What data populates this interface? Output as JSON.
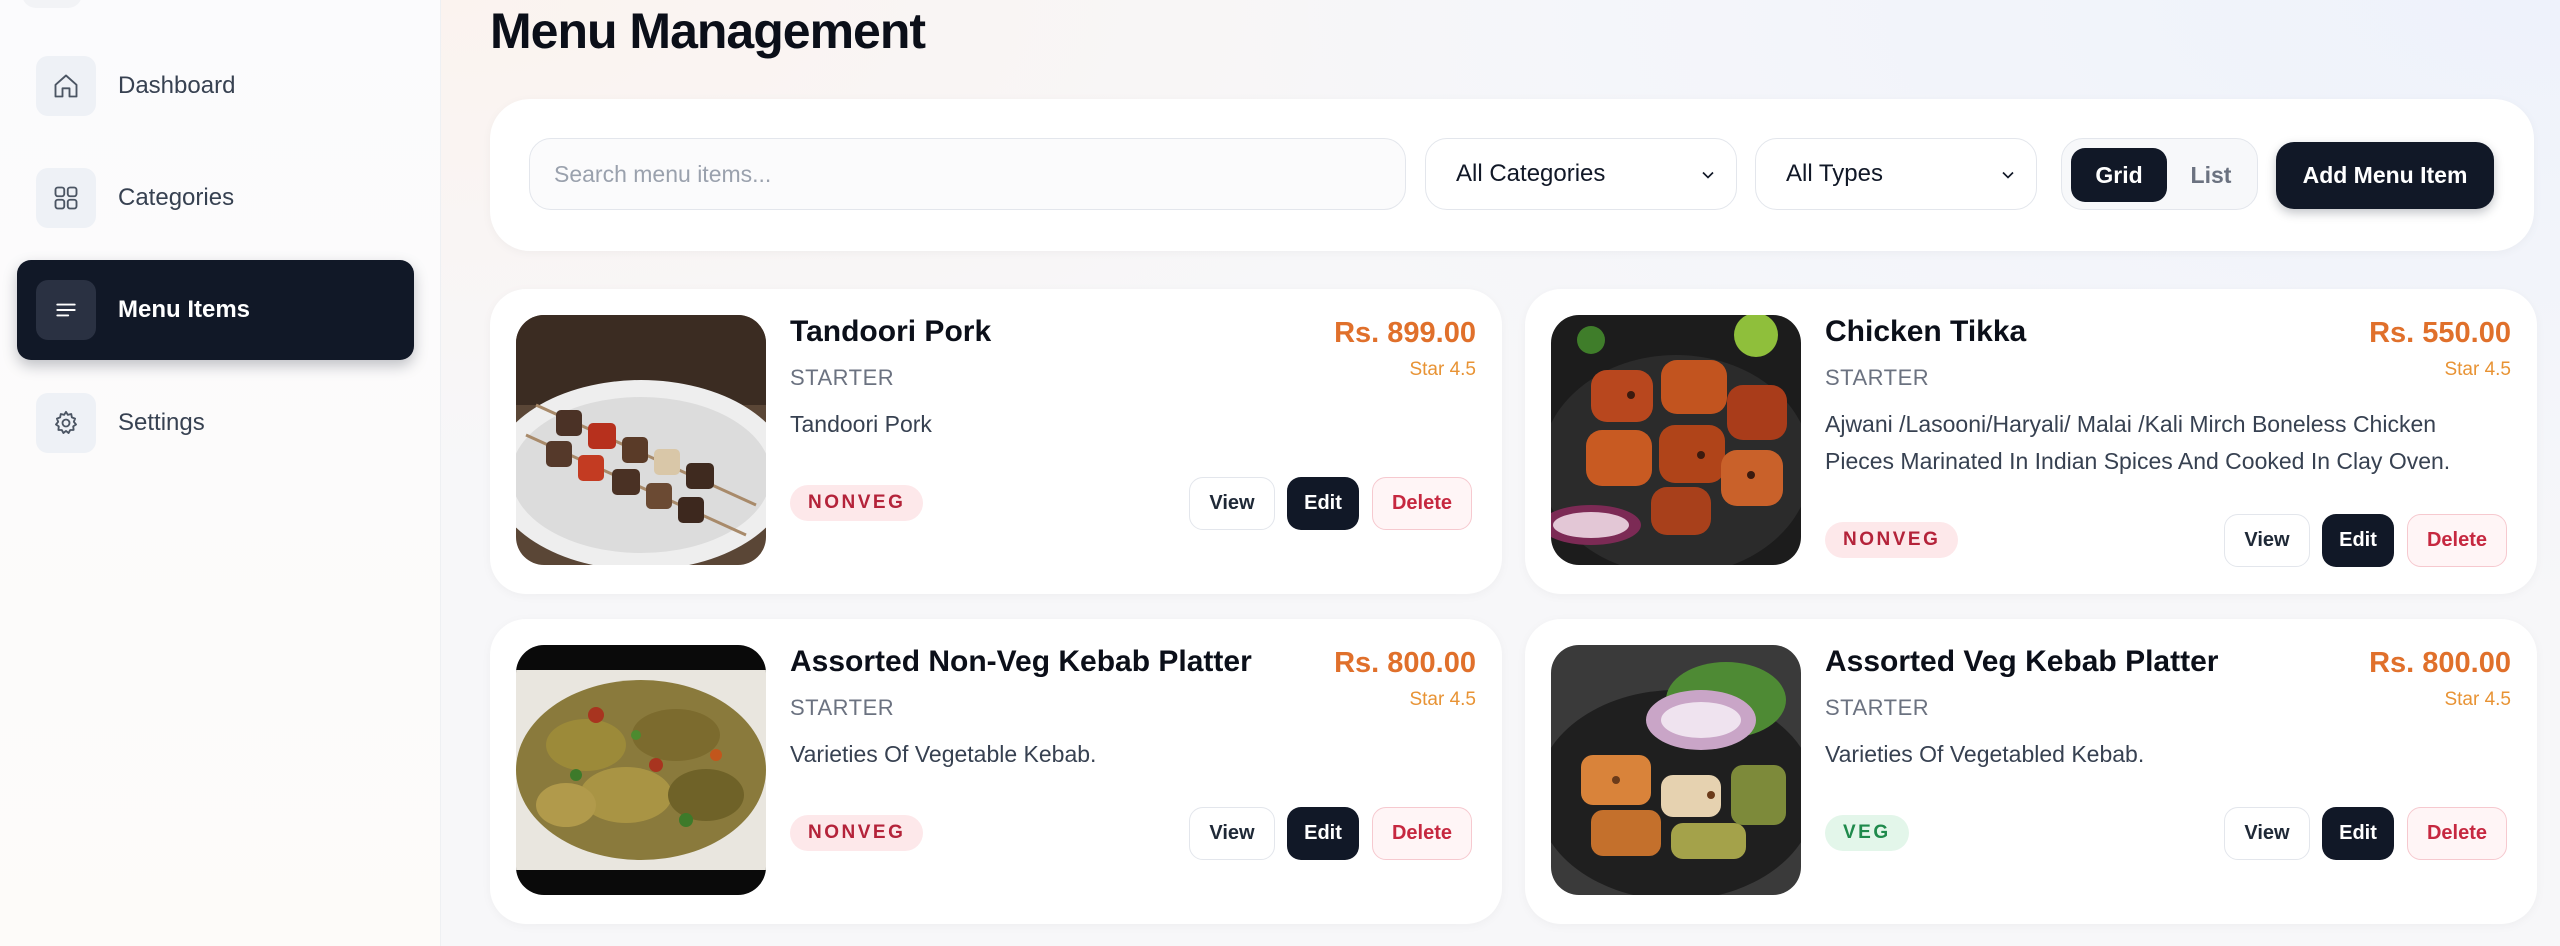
{
  "sidebar": {
    "items": [
      {
        "label": "Dashboard",
        "icon": "home-icon",
        "active": false
      },
      {
        "label": "Categories",
        "icon": "grid-icon",
        "active": false
      },
      {
        "label": "Menu Items",
        "icon": "menu-lines-icon",
        "active": true
      },
      {
        "label": "Settings",
        "icon": "gear-icon",
        "active": false
      }
    ]
  },
  "page": {
    "title": "Menu Management"
  },
  "toolbar": {
    "search_placeholder": "Search menu items...",
    "search_value": "",
    "category_select": "All Categories",
    "type_select": "All Types",
    "view_toggle": {
      "grid": "Grid",
      "list": "List",
      "selected": "Grid"
    },
    "add_label": "Add Menu Item"
  },
  "items": [
    {
      "name": "Tandoori Pork",
      "category": "STARTER",
      "price": "Rs. 899.00",
      "rating": "Star 4.5",
      "description": "Tandoori Pork",
      "type": "NONVEG",
      "actions": {
        "view": "View",
        "edit": "Edit",
        "delete": "Delete"
      }
    },
    {
      "name": "Chicken Tikka",
      "category": "STARTER",
      "price": "Rs. 550.00",
      "rating": "Star 4.5",
      "description": "Ajwani /Lasooni/Haryali/ Malai /Kali Mirch Boneless Chicken Pieces Marinated In Indian Spices And Cooked In Clay Oven.",
      "type": "NONVEG",
      "actions": {
        "view": "View",
        "edit": "Edit",
        "delete": "Delete"
      }
    },
    {
      "name": "Assorted Non-Veg Kebab Platter",
      "category": "STARTER",
      "price": "Rs. 800.00",
      "rating": "Star 4.5",
      "description": "Varieties Of Vegetable Kebab.",
      "type": "NONVEG",
      "actions": {
        "view": "View",
        "edit": "Edit",
        "delete": "Delete"
      }
    },
    {
      "name": "Assorted Veg Kebab Platter",
      "category": "STARTER",
      "price": "Rs. 800.00",
      "rating": "Star 4.5",
      "description": "Varieties Of Vegetabled Kebab.",
      "type": "VEG",
      "actions": {
        "view": "View",
        "edit": "Edit",
        "delete": "Delete"
      }
    }
  ],
  "colors": {
    "primary": "#111827",
    "price": "#e0702b",
    "rating": "#e89334",
    "nonveg_badge": "#b4233a",
    "veg_badge": "#1f8a4c",
    "delete": "#c62840"
  }
}
